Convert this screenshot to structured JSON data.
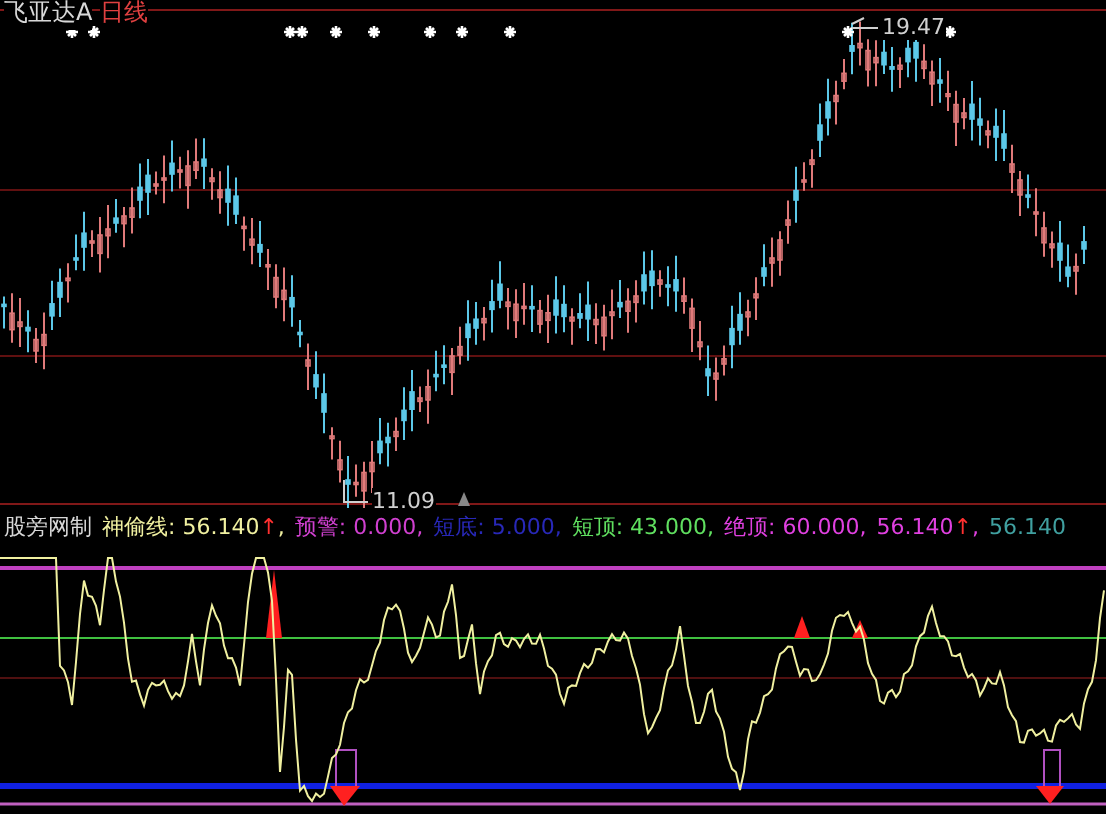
{
  "chart_header": {
    "security": "飞亚达A",
    "period": "日线"
  },
  "price_labels": {
    "high": "19.47",
    "low": "11.09"
  },
  "indicator": {
    "title": "股旁网制",
    "legend": [
      {
        "label": "神偷线:",
        "value": "56.140",
        "arrow": "↑",
        "sep": ",",
        "color": "#f0f0a0"
      },
      {
        "label": "预警:",
        "value": "0.000",
        "sep": ",",
        "color": "#d040d0"
      },
      {
        "label": "短底:",
        "value": "5.000",
        "sep": ",",
        "color": "#2828b8"
      },
      {
        "label": "短顶:",
        "value": "43.000",
        "sep": ",",
        "color": "#60e060"
      },
      {
        "label": "绝顶:",
        "value": "60.000",
        "sep": ",",
        "color": "#e040e0"
      },
      {
        "value": "56.140",
        "arrow": "↑",
        "sep": ",",
        "color": "#e040e0"
      },
      {
        "value": "56.140",
        "color": "#40a0a0"
      }
    ]
  }
}
